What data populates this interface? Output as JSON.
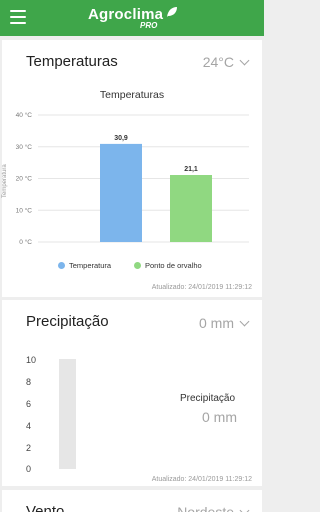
{
  "header": {
    "brand_name": "Agroclima",
    "brand_sub": "PRO",
    "bg_color": "#3fa64a"
  },
  "temperature_card": {
    "title": "Temperaturas",
    "current_value": "24°C",
    "updated": "Atualizado: 24/01/2019 11:29:12"
  },
  "chart_data": {
    "type": "bar",
    "title": "Temperaturas",
    "categories": [
      "Temperatura",
      "Ponto de orvalho"
    ],
    "values": [
      30.9,
      21.1
    ],
    "value_labels": [
      "30,9",
      "21,1"
    ],
    "colors": [
      "#7cb5ec",
      "#90d881"
    ],
    "ylabel": "Temperatura",
    "ylim": [
      0,
      40
    ],
    "yticks": [
      0,
      10,
      20,
      30,
      40
    ],
    "ytick_labels": [
      "0 °C",
      "10 °C",
      "20 °C",
      "30 °C",
      "40 °C"
    ],
    "legend": [
      "Temperatura",
      "Ponto de orvalho"
    ],
    "legend_position": "bottom",
    "grid": true
  },
  "precip_card": {
    "title": "Precipitação",
    "current_value": "0 mm",
    "scale": [
      "10",
      "8",
      "6",
      "4",
      "2",
      "0"
    ],
    "gauge_label": "Precipitação",
    "gauge_value": "0 mm",
    "gauge_level": 0,
    "updated": "Atualizado: 24/01/2019 11:29:12"
  },
  "wind_card": {
    "title": "Vento",
    "current_value": "Nordeste"
  }
}
